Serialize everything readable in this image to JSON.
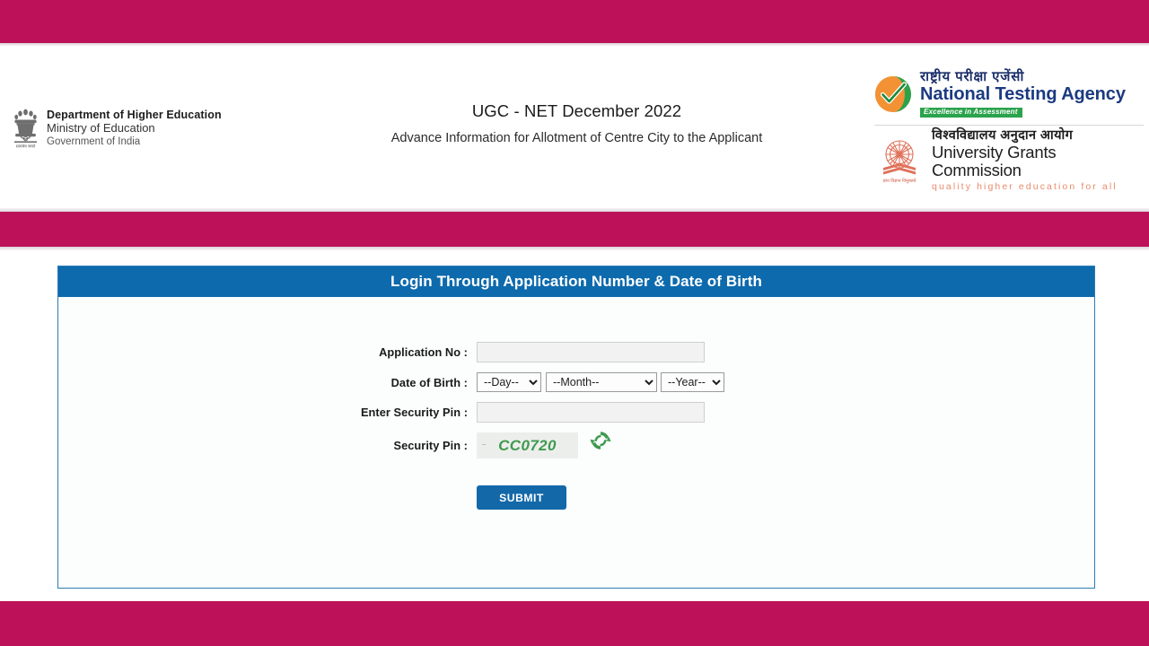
{
  "theme": {
    "band_color": "#bd1259",
    "panel_header_color": "#0d6aad",
    "panel_border_color": "#2b7cb7",
    "submit_color": "#1368a8",
    "captcha_text_color": "#3e9a4e",
    "refresh_icon_color": "#3e9a4e"
  },
  "header": {
    "department": {
      "line1": "Department of Higher Education",
      "line2": "Ministry of Education",
      "line3": "Government of India",
      "emblem_name": "state-emblem-of-india"
    },
    "title": "UGC - NET December 2022",
    "subtitle": "Advance Information for Allotment of Centre City to the Applicant",
    "nta_logo": {
      "hindi": "राष्ट्रीय  परीक्षा  एजेंसी",
      "english": "National Testing Agency",
      "tagline": "Excellence in Assessment"
    },
    "ugc_logo": {
      "hindi": "विश्वविद्यालय अनुदान आयोग",
      "english": "University Grants Commission",
      "tagline": "quality  higher  education  for  all"
    }
  },
  "login_panel": {
    "heading": "Login Through Application Number & Date of Birth",
    "fields": {
      "application_no": {
        "label": "Application No :",
        "value": "",
        "placeholder": ""
      },
      "date_of_birth": {
        "label": "Date of Birth :",
        "day": {
          "selected": "--Day--",
          "options": [
            "--Day--"
          ]
        },
        "month": {
          "selected": "--Month--",
          "options": [
            "--Month--"
          ]
        },
        "year": {
          "selected": "--Year--",
          "options": [
            "--Year--"
          ]
        }
      },
      "enter_security_pin": {
        "label": "Enter Security Pin :",
        "value": "",
        "placeholder": ""
      },
      "security_pin": {
        "label": "Security Pin :",
        "captcha_value": "CC0720",
        "refresh_icon": "refresh-icon"
      }
    },
    "submit_label": "SUBMIT"
  }
}
